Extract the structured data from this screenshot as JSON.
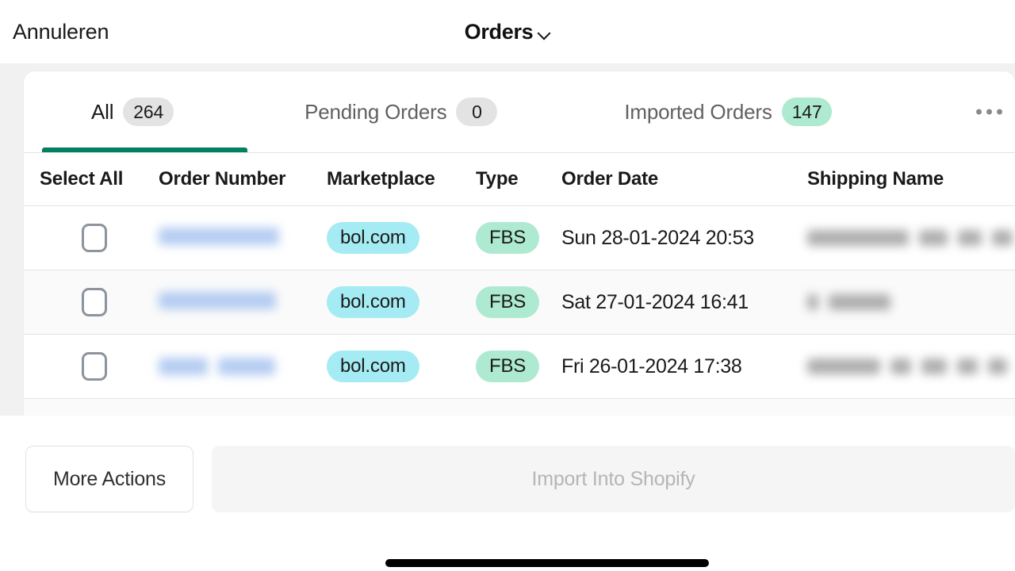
{
  "topbar": {
    "cancel_label": "Annuleren",
    "title": "Orders",
    "dropdown_icon": "chevron-down-icon"
  },
  "tabs": {
    "items": [
      {
        "label": "All",
        "count": "264",
        "badge_style": "grey",
        "active": true
      },
      {
        "label": "Pending Orders",
        "count": "0",
        "badge_style": "grey",
        "active": false
      },
      {
        "label": "Imported Orders",
        "count": "147",
        "badge_style": "green",
        "active": false
      }
    ],
    "overflow_icon": "ellipsis-icon"
  },
  "table": {
    "columns": [
      "Select All",
      "Order Number",
      "Marketplace",
      "Type",
      "Order Date",
      "Shipping Name"
    ],
    "rows": [
      {
        "selected": false,
        "order_number": "",
        "order_number_redacted": true,
        "marketplace": "bol.com",
        "type": "FBS",
        "order_date": "Sun 28-01-2024 20:53",
        "shipping_name": "",
        "shipping_name_redacted": true
      },
      {
        "selected": false,
        "order_number": "",
        "order_number_redacted": true,
        "marketplace": "bol.com",
        "type": "FBS",
        "order_date": "Sat 27-01-2024 16:41",
        "shipping_name": "",
        "shipping_name_redacted": true
      },
      {
        "selected": false,
        "order_number": "",
        "order_number_redacted": true,
        "marketplace": "bol.com",
        "type": "FBS",
        "order_date": "Fri 26-01-2024 17:38",
        "shipping_name": "",
        "shipping_name_redacted": true
      }
    ]
  },
  "footer": {
    "more_actions_label": "More Actions",
    "import_label": "Import Into Shopify",
    "import_disabled": true
  },
  "colors": {
    "accent_green": "#008060",
    "badge_green": "#aee9d1",
    "badge_grey": "#e3e3e3",
    "pill_marketplace": "#a4ebf3",
    "pill_type": "#aee9d1",
    "page_background": "#f1f1f1"
  }
}
